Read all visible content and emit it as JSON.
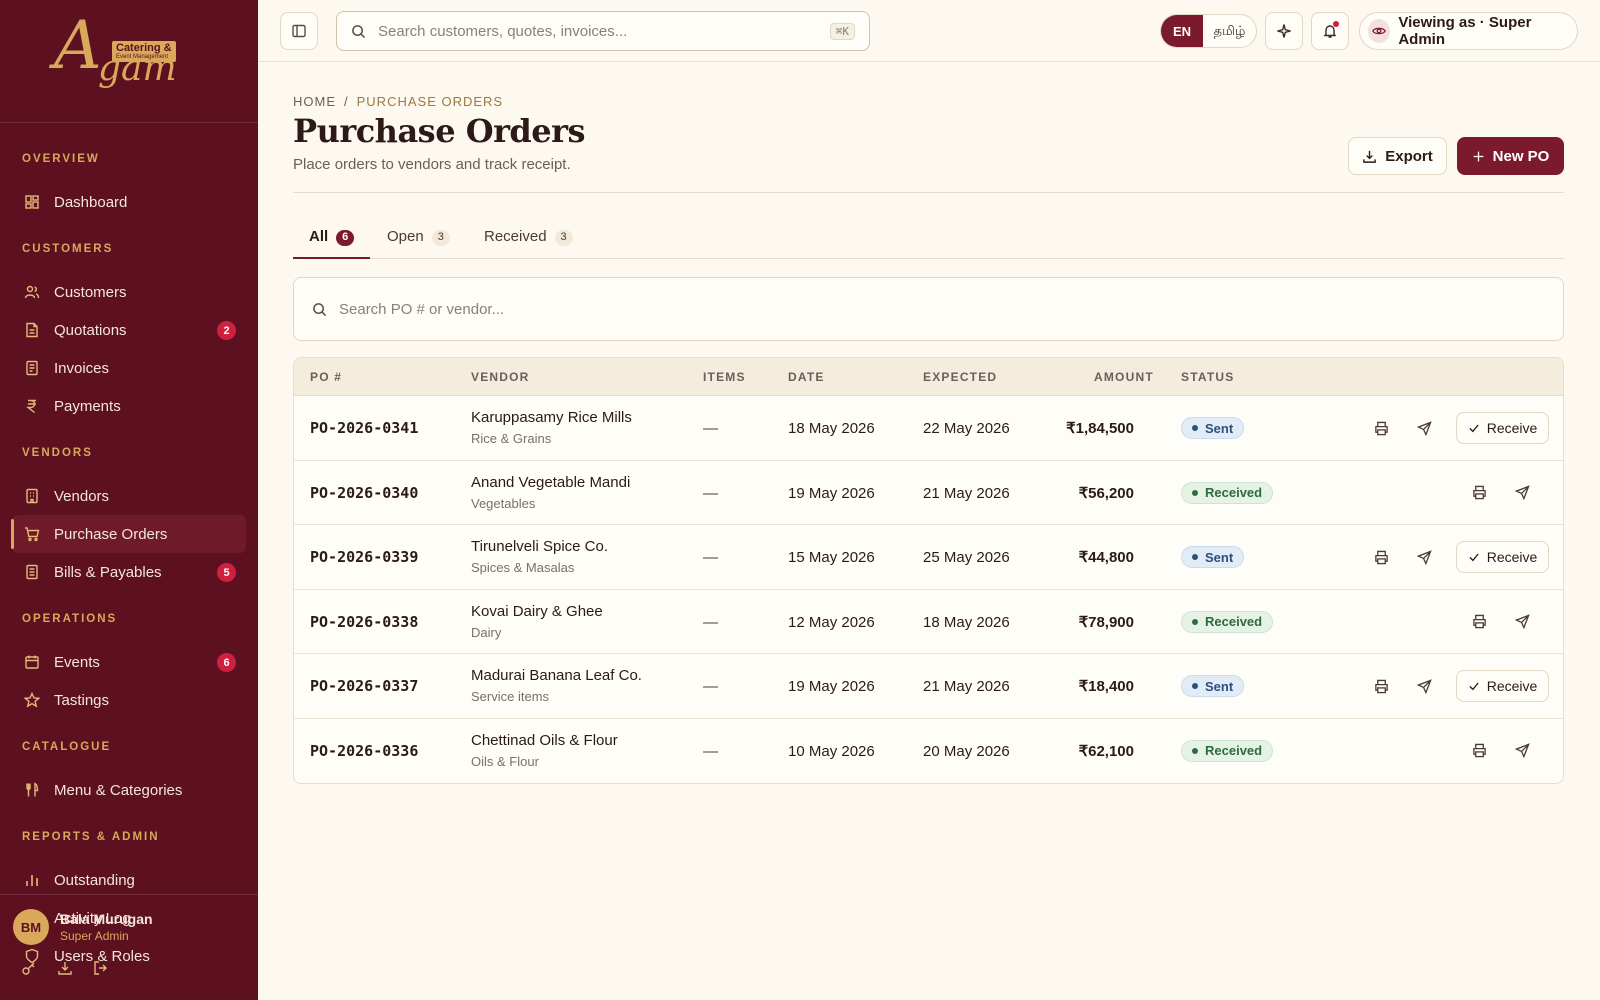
{
  "brand": {
    "logo_text": "Agam",
    "logo_tag": "Catering &",
    "logo_tag_sub": "Event Management"
  },
  "sidebar": {
    "sections": [
      {
        "title": "OVERVIEW",
        "items": [
          {
            "label": "Dashboard",
            "icon": "grid-icon"
          }
        ]
      },
      {
        "title": "CUSTOMERS",
        "items": [
          {
            "label": "Customers",
            "icon": "users-icon"
          },
          {
            "label": "Quotations",
            "icon": "document-icon",
            "badge": "2"
          },
          {
            "label": "Invoices",
            "icon": "receipt-icon"
          },
          {
            "label": "Payments",
            "icon": "rupee-icon"
          }
        ]
      },
      {
        "title": "VENDORS",
        "items": [
          {
            "label": "Vendors",
            "icon": "building-icon"
          },
          {
            "label": "Purchase Orders",
            "icon": "cart-icon",
            "active": true
          },
          {
            "label": "Bills & Payables",
            "icon": "bill-icon",
            "badge": "5"
          }
        ]
      },
      {
        "title": "OPERATIONS",
        "items": [
          {
            "label": "Events",
            "icon": "calendar-icon",
            "badge": "6"
          },
          {
            "label": "Tastings",
            "icon": "star-icon"
          }
        ]
      },
      {
        "title": "CATALOGUE",
        "items": [
          {
            "label": "Menu & Categories",
            "icon": "utensils-icon"
          }
        ]
      },
      {
        "title": "REPORTS & ADMIN",
        "items": [
          {
            "label": "Outstanding",
            "icon": "bar-chart-icon"
          },
          {
            "label": "Activity Log",
            "icon": "list-icon"
          },
          {
            "label": "Users & Roles",
            "icon": "shield-icon"
          }
        ]
      }
    ],
    "user": {
      "initials": "BM",
      "name": "Bala Murugan",
      "role": "Super Admin"
    }
  },
  "topbar": {
    "search_placeholder": "Search customers, quotes, invoices...",
    "shortcut": "⌘K",
    "lang_en": "EN",
    "lang_ta": "தமிழ்",
    "viewing_as": "Viewing as · Super Admin"
  },
  "page": {
    "breadcrumb_home": "HOME",
    "breadcrumb_sep": "/",
    "breadcrumb_current": "PURCHASE ORDERS",
    "title": "Purchase Orders",
    "subtitle": "Place orders to vendors and track receipt.",
    "export_label": "Export",
    "new_label": "New PO"
  },
  "tabs": [
    {
      "label": "All",
      "count": "6",
      "active": true
    },
    {
      "label": "Open",
      "count": "3"
    },
    {
      "label": "Received",
      "count": "3"
    }
  ],
  "table": {
    "search_placeholder": "Search PO # or vendor...",
    "columns": {
      "po": "PO #",
      "vendor": "VENDOR",
      "items": "ITEMS",
      "date": "DATE",
      "expected": "EXPECTED",
      "amount": "AMOUNT",
      "status": "STATUS"
    },
    "receive_label": "Receive",
    "rows": [
      {
        "po": "PO-2026-0341",
        "vendor": "Karuppasamy Rice Mills",
        "category": "Rice & Grains",
        "items": "—",
        "date": "18 May 2026",
        "expected": "22 May 2026",
        "amount": "₹1,84,500",
        "status": "Sent"
      },
      {
        "po": "PO-2026-0340",
        "vendor": "Anand Vegetable Mandi",
        "category": "Vegetables",
        "items": "—",
        "date": "19 May 2026",
        "expected": "21 May 2026",
        "amount": "₹56,200",
        "status": "Received"
      },
      {
        "po": "PO-2026-0339",
        "vendor": "Tirunelveli Spice Co.",
        "category": "Spices & Masalas",
        "items": "—",
        "date": "15 May 2026",
        "expected": "25 May 2026",
        "amount": "₹44,800",
        "status": "Sent"
      },
      {
        "po": "PO-2026-0338",
        "vendor": "Kovai Dairy & Ghee",
        "category": "Dairy",
        "items": "—",
        "date": "12 May 2026",
        "expected": "18 May 2026",
        "amount": "₹78,900",
        "status": "Received"
      },
      {
        "po": "PO-2026-0337",
        "vendor": "Madurai Banana Leaf Co.",
        "category": "Service items",
        "items": "—",
        "date": "19 May 2026",
        "expected": "21 May 2026",
        "amount": "₹18,400",
        "status": "Sent"
      },
      {
        "po": "PO-2026-0336",
        "vendor": "Chettinad Oils & Flour",
        "category": "Oils & Flour",
        "items": "—",
        "date": "10 May 2026",
        "expected": "20 May 2026",
        "amount": "₹62,100",
        "status": "Received"
      }
    ]
  },
  "colors": {
    "accent": "#7b1a2c",
    "sidebar": "#5c1020",
    "gold": "#d9a85a",
    "background": "#fdf9f1"
  }
}
